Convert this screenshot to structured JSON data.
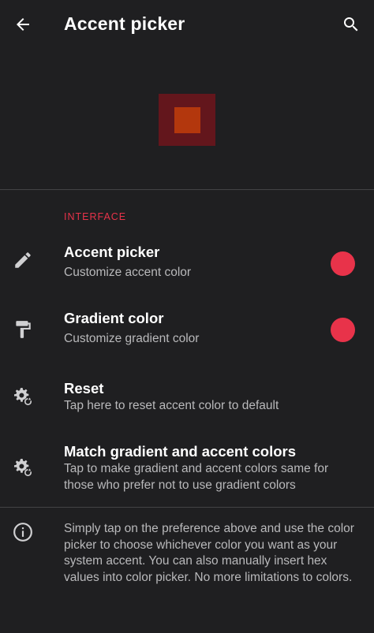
{
  "appbar": {
    "title": "Accent picker",
    "back_icon": "arrow-back-icon",
    "search_icon": "search-icon"
  },
  "preview": {
    "outer_color": "#63161c",
    "inner_color": "#b3370d"
  },
  "section": {
    "header": "INTERFACE"
  },
  "preferences": [
    {
      "title": "Accent picker",
      "summary": "Customize accent color",
      "icon": "pencil-icon",
      "swatch_color": "#e8334a"
    },
    {
      "title": "Gradient color",
      "summary": "Customize gradient color",
      "icon": "paint-roller-icon",
      "swatch_color": "#e8334a"
    },
    {
      "title": "Reset",
      "summary": "Tap here to reset accent color to default",
      "icon": "settings-backup-restore-icon"
    },
    {
      "title": "Match gradient and accent colors",
      "summary": "Tap to make gradient and accent colors same for those who prefer not to use gradient colors",
      "icon": "settings-backup-restore-icon"
    }
  ],
  "footer": {
    "icon": "info-icon",
    "text": "Simply tap on the preference above and use the color picker to choose whichever color you want as your system accent. You can also manually insert hex values into color picker. No more limitations to colors."
  },
  "colors": {
    "background": "#1f1f21",
    "accent": "#e8334a",
    "secondary_text": "#b9b9bb",
    "divider": "#434345"
  }
}
